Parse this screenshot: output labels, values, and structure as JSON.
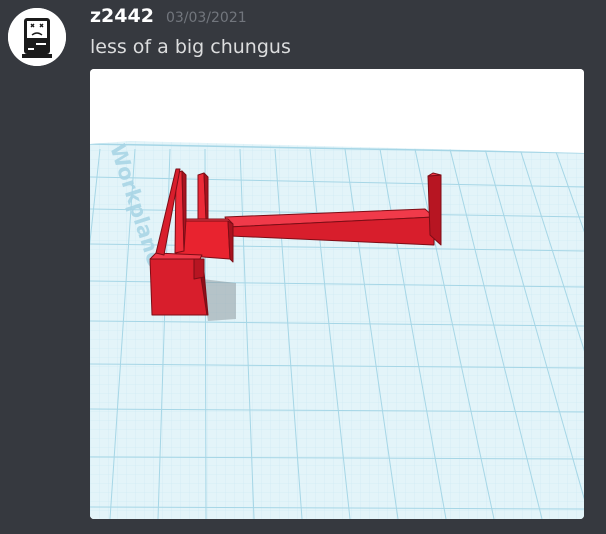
{
  "message": {
    "author": "z2442",
    "timestamp": "03/03/2021",
    "content": "less of a big chungus"
  },
  "avatar": {
    "icon": "sad-computer-icon"
  },
  "attachment": {
    "icon": "3d-model-render",
    "workplane_label": "Workplane",
    "colors": {
      "model": "#d81e2c",
      "grid": "#bde3ef",
      "background": "#ffffff"
    }
  }
}
